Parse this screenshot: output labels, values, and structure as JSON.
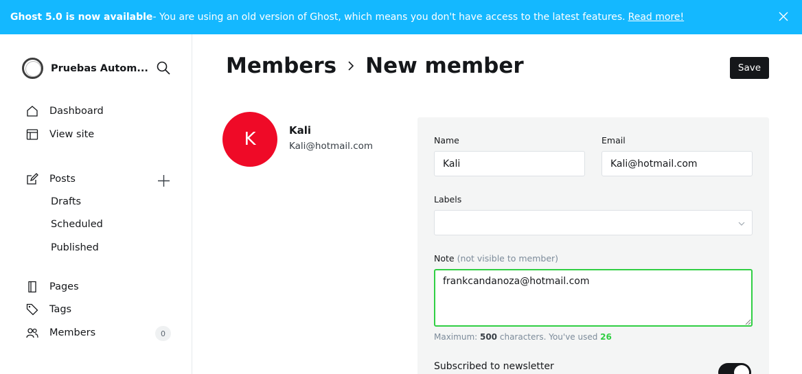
{
  "banner": {
    "version_title": "Ghost 5.0 is now available",
    "message": " - You are using an old version of Ghost, which means you don't have access to the latest features.",
    "link": "Read more!"
  },
  "sidebar": {
    "site_name": "Pruebas Autom...",
    "items": [
      {
        "label": "Dashboard",
        "icon": "home-icon"
      },
      {
        "label": "View site",
        "icon": "layout-icon"
      },
      {
        "label": "Posts",
        "icon": "pencil-icon"
      },
      {
        "label": "Pages",
        "icon": "pages-icon"
      },
      {
        "label": "Tags",
        "icon": "tag-icon"
      },
      {
        "label": "Members",
        "icon": "members-icon"
      }
    ],
    "post_subitems": [
      "Drafts",
      "Scheduled",
      "Published"
    ],
    "members_count": "0"
  },
  "header": {
    "breadcrumb_parent": "Members",
    "breadcrumb_current": "New member",
    "save_label": "Save"
  },
  "member": {
    "initial": "K",
    "name": "Kali",
    "email": "Kali@hotmail.com"
  },
  "form": {
    "name_label": "Name",
    "name_value": "Kali",
    "email_label": "Email",
    "email_value": "Kali@hotmail.com",
    "labels_label": "Labels",
    "note_label": "Note",
    "note_hint": "(not visible to member)",
    "note_value": "frankcandanoza@hotmail.com",
    "max_prefix": "Maximum: ",
    "max_value": "500",
    "max_suffix": " characters. You've used ",
    "used_value": "26",
    "newsletter_label": "Subscribed to newsletter",
    "newsletter_on": true
  },
  "colors": {
    "banner": "#14b8ff",
    "avatar": "#ef0a27",
    "focus_green": "#30cf43"
  }
}
